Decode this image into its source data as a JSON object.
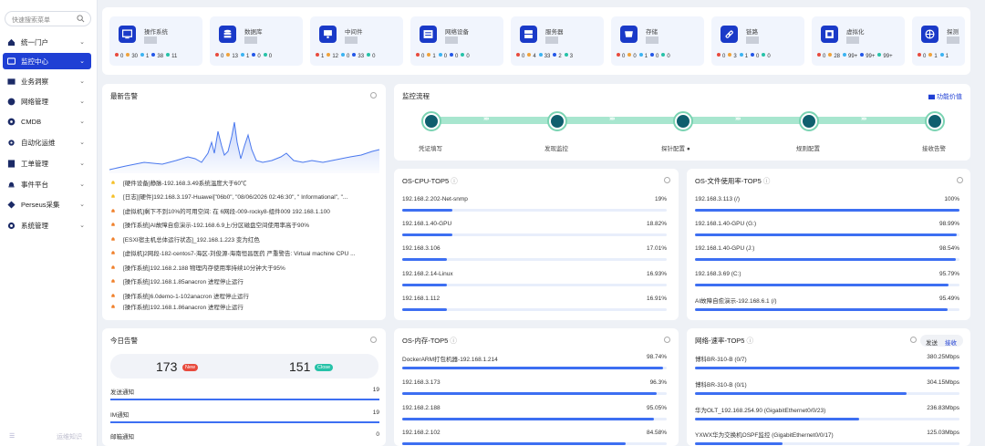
{
  "sidebar": {
    "search_placeholder": "快速搜索菜单",
    "items": [
      {
        "label": "统一门户",
        "icon": "home-icon"
      },
      {
        "label": "监控中心",
        "icon": "monitor-icon"
      },
      {
        "label": "业务洞察",
        "icon": "insight-icon"
      },
      {
        "label": "网络管理",
        "icon": "globe-icon"
      },
      {
        "label": "CMDB",
        "icon": "cmdb-icon"
      },
      {
        "label": "自动化运维",
        "icon": "gear-icon"
      },
      {
        "label": "工单管理",
        "icon": "ticket-icon"
      },
      {
        "label": "事件平台",
        "icon": "bell-icon"
      },
      {
        "label": "Perseus采集",
        "icon": "diamond-icon"
      },
      {
        "label": "系统管理",
        "icon": "settings-icon"
      }
    ],
    "footer_label": "运维知识"
  },
  "top_cards": [
    {
      "name": "操作系统",
      "counts": [
        "0",
        "30",
        "1",
        "38",
        "11"
      ]
    },
    {
      "name": "数据库",
      "counts": [
        "0",
        "13",
        "1",
        "0",
        "0"
      ]
    },
    {
      "name": "中间件",
      "counts": [
        "1",
        "12",
        "0",
        "33",
        "0"
      ]
    },
    {
      "name": "网络设备",
      "counts": [
        "0",
        "1",
        "0",
        "0",
        "0"
      ]
    },
    {
      "name": "服务器",
      "counts": [
        "0",
        "4",
        "33",
        "2",
        "3"
      ]
    },
    {
      "name": "存储",
      "counts": [
        "0",
        "0",
        "1",
        "0",
        "0"
      ]
    },
    {
      "name": "链路",
      "counts": [
        "0",
        "3",
        "1",
        "0",
        "0"
      ]
    },
    {
      "name": "虚拟化",
      "counts": [
        "0",
        "28",
        "99+",
        "99+",
        "99+"
      ]
    },
    {
      "name": "探测",
      "counts": [
        "0",
        "1",
        "1"
      ]
    }
  ],
  "status_colors": [
    "#e84a3d",
    "#f0a23a",
    "#3bb3f2",
    "#2357e8",
    "#26c2a8"
  ],
  "latest_alerts": {
    "title": "最新告警",
    "items": [
      "[硬件设备]静脉-192.168.3.49系统温度大于60℃",
      "[日志][硬件]192.168.3.197-Huawei[\"06b0\", \"08/06/2026 02:46:30\", \" Informational\", \"...",
      "[虚拟机]剩下不到10%的可用空间: 在 6网段-009-rocky8-组件009 192.168.1.100",
      "[操作系统]AI故障自愈演示-192.168.6.9上/分区磁盘空间使用率高于90%",
      "[ESXI宿主机总体运行状态]_192.168.1.223 变为红色",
      "[虚拟机]2网段-182-centos7-海区-刘俊源-海南恒昌医药 严重警告: Virtual machine CPU ...",
      "[操作系统]192.168.2.188 物理内存使用率持续10分钟大于95%",
      "[操作系统]192.168.1.85anacron 进程停止运行",
      "[操作系统]6.0demo-1-102anacron 进程停止运行",
      "[操作系统]192.168.1.86anacron 进程停止运行"
    ]
  },
  "flow": {
    "title": "监控流程",
    "link": "功能价值",
    "steps": [
      "凭证填写",
      "发现监控",
      "探针配置",
      "规则配置",
      "接收告警"
    ]
  },
  "cpu": {
    "title": "OS-CPU-TOP5",
    "rows": [
      {
        "label": "192.168.2.202-Net-snmp",
        "value": "19%",
        "pct": 19
      },
      {
        "label": "192.168.1.40-GPU",
        "value": "18.82%",
        "pct": 18.82
      },
      {
        "label": "192.168.3.106",
        "value": "17.01%",
        "pct": 17.01
      },
      {
        "label": "192.168.2.14-Linux",
        "value": "16.93%",
        "pct": 16.93
      },
      {
        "label": "192.168.1.112",
        "value": "16.91%",
        "pct": 16.91
      }
    ]
  },
  "fs": {
    "title": "OS-文件使用率-TOP5",
    "rows": [
      {
        "label": "192.168.3.113  (/)",
        "value": "100%",
        "pct": 100
      },
      {
        "label": "192.168.1.40-GPU  (G:)",
        "value": "98.99%",
        "pct": 98.99
      },
      {
        "label": "192.168.1.40-GPU  (J:)",
        "value": "98.54%",
        "pct": 98.54
      },
      {
        "label": "192.168.3.69  (C:)",
        "value": "95.79%",
        "pct": 95.79
      },
      {
        "label": "AI故障自愈演示-192.168.6.1  (/)",
        "value": "95.49%",
        "pct": 95.49
      }
    ]
  },
  "today": {
    "title": "今日告警",
    "new_count": "173",
    "new_tag": "New",
    "close_count": "151",
    "close_tag": "Close",
    "rows": [
      {
        "label": "发送通知",
        "value": "19",
        "pct": 100
      },
      {
        "label": "IM通知",
        "value": "19",
        "pct": 100
      },
      {
        "label": "邮箱通知",
        "value": "0",
        "pct": 0
      }
    ]
  },
  "mem": {
    "title": "OS-内存-TOP5",
    "rows": [
      {
        "label": "DockerARM打包机器-192.168.1.214",
        "value": "98.74%",
        "pct": 98.74
      },
      {
        "label": "192.168.3.173",
        "value": "96.3%",
        "pct": 96.3
      },
      {
        "label": "192.168.2.188",
        "value": "95.05%",
        "pct": 95.05
      },
      {
        "label": "192.168.2.102",
        "value": "84.58%",
        "pct": 84.58
      }
    ]
  },
  "net": {
    "title": "网络-速率-TOP5",
    "send": "发送",
    "recv": "接收",
    "rows": [
      {
        "label": "博科BR-310-B  (0/7)",
        "value": "380.25Mbps",
        "pct": 100
      },
      {
        "label": "博科BR-310-B  (0/1)",
        "value": "304.15Mbps",
        "pct": 80
      },
      {
        "label": "华为OLT_192.168.254.90  (GigabitEthernet0/0/23)",
        "value": "236.83Mbps",
        "pct": 62
      },
      {
        "label": "YXWX华为交换机OSPF监控  (GigabitEthernet0/0/17)",
        "value": "125.03Mbps",
        "pct": 33
      }
    ]
  }
}
